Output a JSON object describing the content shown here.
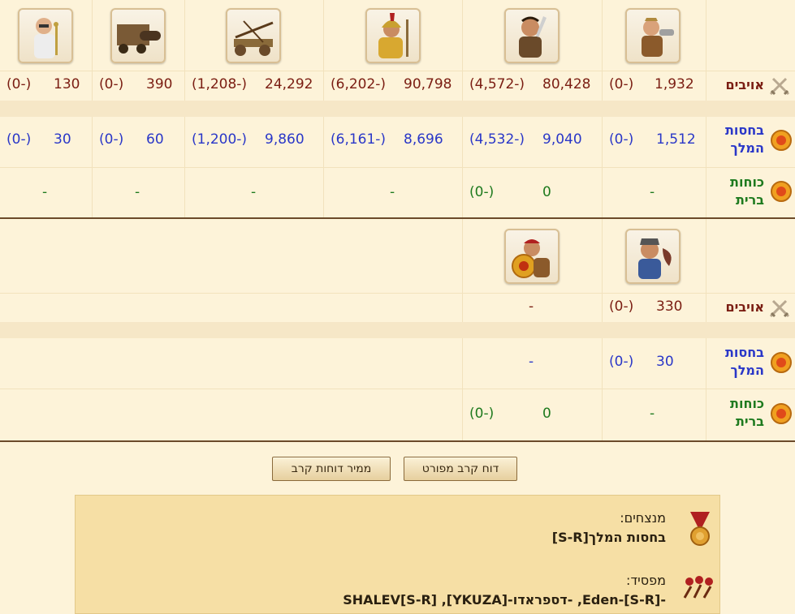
{
  "row_labels": {
    "enemies": "אויבים",
    "king_guard_1": "בחסות",
    "king_guard_2": "המלך",
    "allies_1": "כוחות",
    "allies_2": "ברית"
  },
  "top_table": {
    "units": [
      "archer-unit-icon",
      "swordsman-unit-icon",
      "spartan-unit-icon",
      "ballista-unit-icon",
      "battering-ram-unit-icon",
      "healer-unit-icon"
    ],
    "enemies": [
      {
        "value": "1,932",
        "loss": "(0-)"
      },
      {
        "value": "80,428",
        "loss": "(4,572-)"
      },
      {
        "value": "90,798",
        "loss": "(6,202-)"
      },
      {
        "value": "24,292",
        "loss": "(1,208-)"
      },
      {
        "value": "390",
        "loss": "(0-)"
      },
      {
        "value": "130",
        "loss": "(0-)"
      }
    ],
    "king_guard": [
      {
        "value": "1,512",
        "loss": "(0-)"
      },
      {
        "value": "9,040",
        "loss": "(4,532-)"
      },
      {
        "value": "8,696",
        "loss": "(6,161-)"
      },
      {
        "value": "9,860",
        "loss": "(1,200-)"
      },
      {
        "value": "60",
        "loss": "(0-)"
      },
      {
        "value": "30",
        "loss": "(0-)"
      }
    ],
    "allies": [
      {
        "value": "-",
        "loss": ""
      },
      {
        "value": "0",
        "loss": "(0-)"
      },
      {
        "value": "-",
        "loss": ""
      },
      {
        "value": "-",
        "loss": ""
      },
      {
        "value": "-",
        "loss": ""
      },
      {
        "value": "-",
        "loss": ""
      }
    ]
  },
  "bottom_table": {
    "units": [
      "cook-unit-icon",
      "shield-warrior-unit-icon"
    ],
    "enemies": [
      {
        "value": "330",
        "loss": "(0-)"
      },
      {
        "value": "-",
        "loss": ""
      }
    ],
    "king_guard": [
      {
        "value": "30",
        "loss": "(0-)"
      },
      {
        "value": "-",
        "loss": ""
      }
    ],
    "allies": [
      {
        "value": "-",
        "loss": ""
      },
      {
        "value": "0",
        "loss": "(0-)"
      }
    ]
  },
  "buttons": {
    "detailed_report": "דוח קרב מפורט",
    "convert_reports": "ממיר דוחות קרב"
  },
  "result": {
    "winners_title": "מנצחים:",
    "winners_value": "בחסות המלך[S-R]",
    "losers_title": "מפסיד:",
    "losers_value": "SHALEV[S-R] ,[YKUZA]-דספראדו- ,Eden-[S-R]-"
  },
  "colors": {
    "background": "#fdf3d9",
    "enemy_text": "#7a1d12",
    "king_text": "#2a37c8",
    "ally_text": "#1e7a1e",
    "panel": "#f6dfa5",
    "separator": "#6b4a2a"
  }
}
